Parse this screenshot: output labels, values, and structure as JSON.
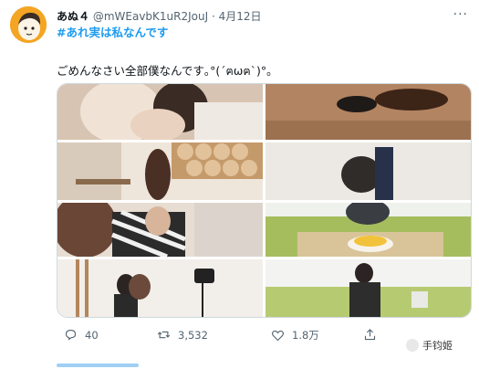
{
  "user": {
    "display_name": "あぬ４",
    "handle": "@mWEavbK1uR2JouJ",
    "separator": "·",
    "date": "4月12日"
  },
  "tweet": {
    "hashtag": "#あれ実は私なんです",
    "text": "ごめんなさい全部僕なんです｡°(´ฅωฅ`)°｡"
  },
  "actions": {
    "reply_count": "40",
    "retweet_count": "3,532",
    "like_count": "1.8万"
  },
  "watermark": {
    "text": "手钧姬"
  },
  "icons": [
    "more-icon",
    "reply-icon",
    "retweet-icon",
    "like-icon",
    "share-icon"
  ],
  "colors": {
    "accent": "#1d9bf0",
    "muted": "#536471",
    "text": "#0f1419"
  }
}
